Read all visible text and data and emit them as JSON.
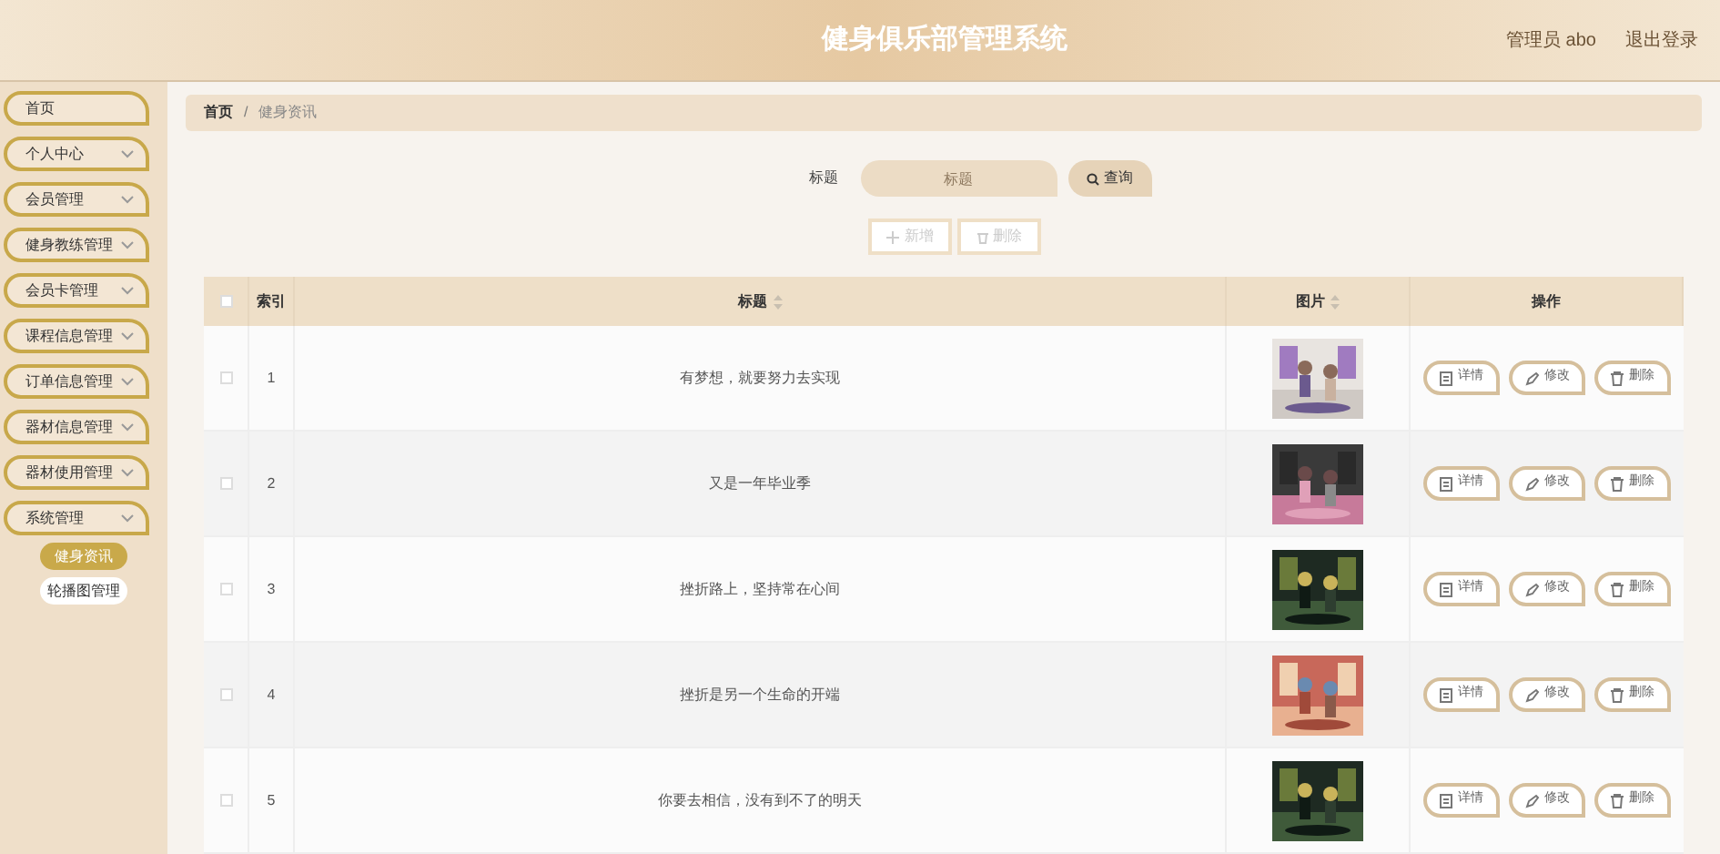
{
  "header": {
    "title": "健身俱乐部管理系统",
    "user": "管理员 abo",
    "logout": "退出登录"
  },
  "sidebar": {
    "items": [
      {
        "label": "首页",
        "expandable": false
      },
      {
        "label": "个人中心",
        "expandable": true
      },
      {
        "label": "会员管理",
        "expandable": true
      },
      {
        "label": "健身教练管理",
        "expandable": true
      },
      {
        "label": "会员卡管理",
        "expandable": true
      },
      {
        "label": "课程信息管理",
        "expandable": true
      },
      {
        "label": "订单信息管理",
        "expandable": true
      },
      {
        "label": "器材信息管理",
        "expandable": true
      },
      {
        "label": "器材使用管理",
        "expandable": true
      },
      {
        "label": "系统管理",
        "expandable": true,
        "children": [
          {
            "label": "健身资讯",
            "selected": true
          },
          {
            "label": "轮播图管理",
            "selected": false
          }
        ]
      }
    ]
  },
  "breadcrumb": {
    "items": [
      "首页",
      "健身资讯"
    ],
    "separator": "/"
  },
  "search": {
    "label": "标题",
    "placeholder": "标题",
    "button": "查询"
  },
  "actions": {
    "add": "新增",
    "delete": "删除"
  },
  "table": {
    "select_all_checked": false,
    "columns": [
      {
        "label": "索引",
        "sortable": false
      },
      {
        "label": "标题",
        "sortable": true
      },
      {
        "label": "图片",
        "sortable": true
      },
      {
        "label": "操作",
        "sortable": false
      }
    ],
    "rows": [
      {
        "index": "1",
        "title": "有梦想，就要努力去实现",
        "checked": false,
        "buttons": [
          "详情",
          "修改",
          "删除"
        ]
      },
      {
        "index": "2",
        "title": "又是一年毕业季",
        "checked": false,
        "buttons": [
          "详情",
          "修改",
          "删除"
        ]
      },
      {
        "index": "3",
        "title": "挫折路上，坚持常在心间",
        "checked": false,
        "buttons": [
          "详情",
          "修改",
          "删除"
        ]
      },
      {
        "index": "4",
        "title": "挫折是另一个生命的开端",
        "checked": false,
        "buttons": [
          "详情",
          "修改",
          "删除"
        ]
      },
      {
        "index": "5",
        "title": "你要去相信，没有到不了的明天",
        "checked": false,
        "buttons": [
          "详情",
          "修改",
          "删除"
        ]
      }
    ]
  }
}
